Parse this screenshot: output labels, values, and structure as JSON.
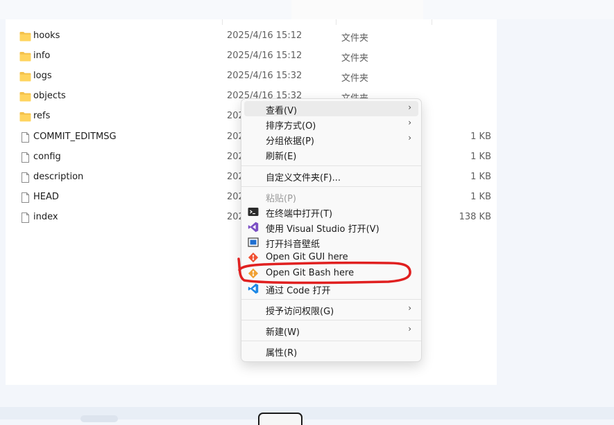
{
  "files": [
    {
      "name": "hooks",
      "date": "2025/4/16 15:12",
      "type": "文件夹",
      "size": "",
      "kind": "folder"
    },
    {
      "name": "info",
      "date": "2025/4/16 15:12",
      "type": "文件夹",
      "size": "",
      "kind": "folder"
    },
    {
      "name": "logs",
      "date": "2025/4/16 15:32",
      "type": "文件夹",
      "size": "",
      "kind": "folder"
    },
    {
      "name": "objects",
      "date": "2025/4/16 15:32",
      "type": "文件夹",
      "size": "",
      "kind": "folder"
    },
    {
      "name": "refs",
      "date": "202",
      "type": "",
      "size": "",
      "kind": "folder"
    },
    {
      "name": "COMMIT_EDITMSG",
      "date": "202",
      "type": "",
      "size": "1 KB",
      "kind": "file"
    },
    {
      "name": "config",
      "date": "202",
      "type": "",
      "size": "1 KB",
      "kind": "file"
    },
    {
      "name": "description",
      "date": "202",
      "type": "",
      "size": "1 KB",
      "kind": "file"
    },
    {
      "name": "HEAD",
      "date": "202",
      "type": "",
      "size": "1 KB",
      "kind": "file"
    },
    {
      "name": "index",
      "date": "202",
      "type": "",
      "size": "138 KB",
      "kind": "file"
    }
  ],
  "menu": {
    "view": "查看(V)",
    "sort": "排序方式(O)",
    "group": "分组依据(P)",
    "refresh": "刷新(E)",
    "customize": "自定义文件夹(F)...",
    "paste": "粘贴(P)",
    "terminal": "在终端中打开(T)",
    "visual_studio": "使用 Visual Studio 打开(V)",
    "wallpaper": "打开抖音壁纸",
    "git_gui": "Open Git GUI here",
    "git_bash": "Open Git Bash here",
    "vscode": "通过 Code 打开",
    "access": "授予访问权限(G)",
    "new": "新建(W)",
    "properties": "属性(R)"
  },
  "icons": {
    "folder": "folder-icon",
    "file": "file-icon",
    "terminal": "terminal-icon",
    "visual_studio": "visual-studio-icon",
    "wallpaper": "wallpaper-icon",
    "git": "git-icon",
    "vscode": "vscode-icon",
    "submenu": "chevron-right-icon"
  },
  "colors": {
    "folder": "#f3c14b",
    "annotation": "#e02020",
    "hover": "#ebebeb",
    "visual_studio": "#7b4fc4",
    "vscode": "#1e88e5",
    "git": "#f05133"
  }
}
